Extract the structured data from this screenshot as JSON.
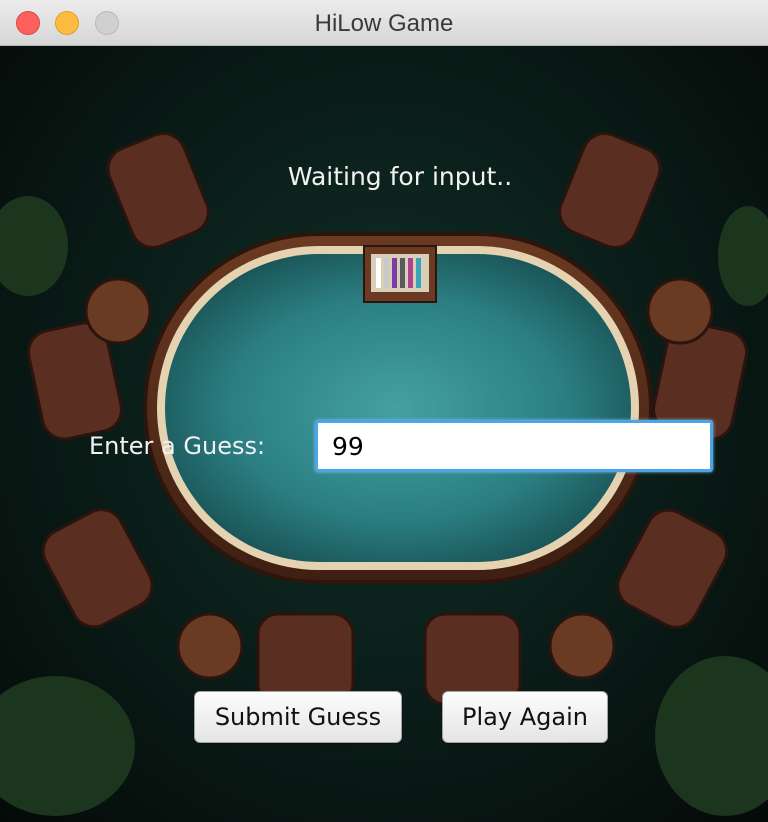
{
  "window": {
    "title": "HiLow Game"
  },
  "game": {
    "status": "Waiting for input..",
    "guess_label": "Enter a Guess:",
    "guess_value": "99"
  },
  "buttons": {
    "submit_label": "Submit Guess",
    "play_again_label": "Play Again"
  },
  "colors": {
    "felt": "#2e8a8c",
    "background": "#0b1f1a",
    "input_focus": "#4aa6e8"
  }
}
